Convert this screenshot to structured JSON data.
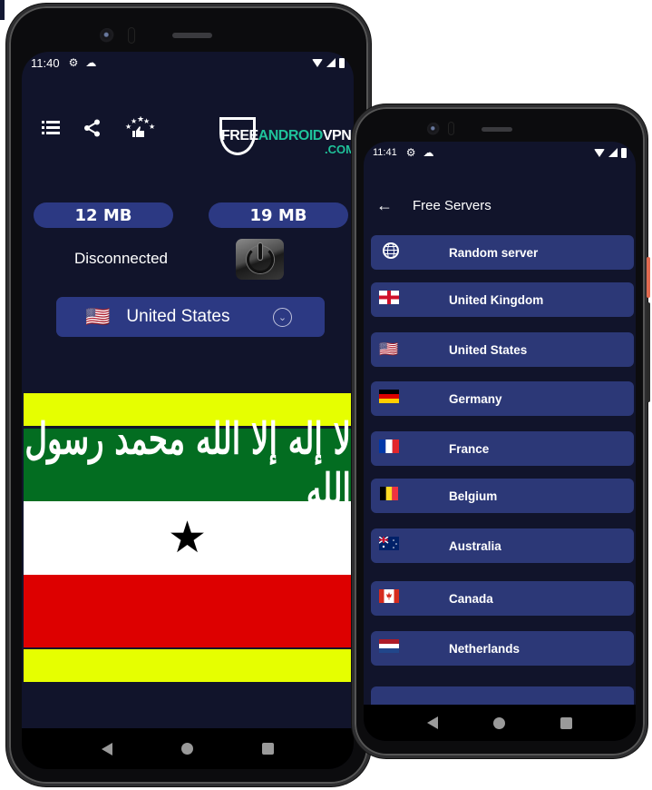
{
  "left_phone": {
    "status_bar": {
      "time": "11:40"
    },
    "toolbar": {
      "icons": [
        "list-icon",
        "share-icon",
        "rate-icon"
      ]
    },
    "logo": {
      "part1": "FREE",
      "part2": "ANDROID",
      "part3": "VPN",
      "part4": ".COM"
    },
    "traffic": {
      "download": "12 MB",
      "upload": "19 MB"
    },
    "connection_status": "Disconnected",
    "selected_country": {
      "flag": "🇺🇸",
      "name": "United States"
    },
    "banner": {
      "arabic_text": "لا إله إلا الله محمد رسول الله",
      "star": "★",
      "colors": {
        "yellow": "#e6ff00",
        "green": "#036d21",
        "white": "#ffffff",
        "red": "#dd0000"
      }
    }
  },
  "right_phone": {
    "status_bar": {
      "time": "11:41"
    },
    "header": {
      "back": "←",
      "title": "Free Servers"
    },
    "servers": [
      {
        "flag": "globe",
        "name": "Random server"
      },
      {
        "flag": "🏴󠁧󠁢󠁥󠁮󠁧󠁿",
        "name": "United Kingdom"
      },
      {
        "flag": "🇺🇸",
        "name": "United States"
      },
      {
        "flag": "🇩🇪",
        "name": "Germany"
      },
      {
        "flag": "🇫🇷",
        "name": "France"
      },
      {
        "flag": "🇧🇪",
        "name": "Belgium"
      },
      {
        "flag": "🇦🇺",
        "name": "Australia"
      },
      {
        "flag": "🇨🇦",
        "name": "Canada"
      },
      {
        "flag": "🇳🇱",
        "name": "Netherlands"
      }
    ]
  },
  "colors": {
    "background": "#11142b",
    "accent": "#2c3983",
    "list_item": "#2c3877",
    "logo_teal": "#1fc29a"
  }
}
